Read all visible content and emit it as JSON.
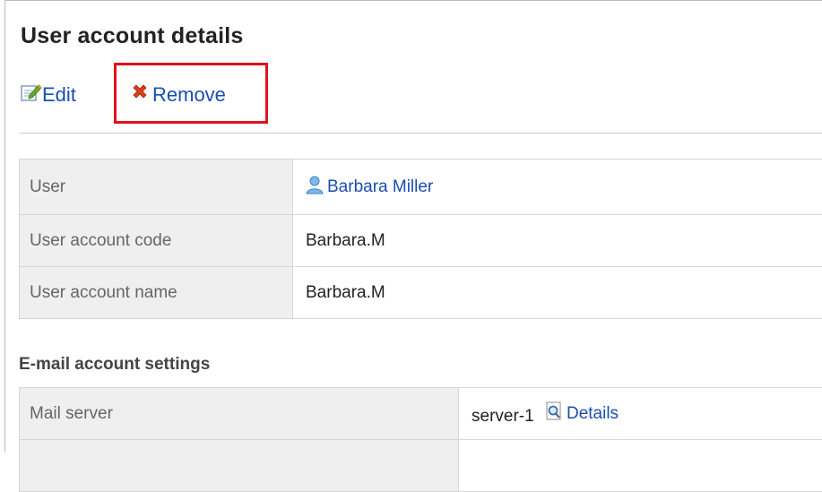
{
  "page": {
    "title": "User account details"
  },
  "toolbar": {
    "edit_label": "Edit",
    "remove_label": "Remove",
    "edit_icon": "edit-icon",
    "remove_icon": "remove-x-icon",
    "highlight_color": "#e0121b"
  },
  "account": {
    "rows": [
      {
        "label": "User",
        "value": "Barbara Miller",
        "icon": "user-icon"
      },
      {
        "label": "User account code",
        "value": "Barbara.M"
      },
      {
        "label": "User account name",
        "value": "Barbara.M"
      }
    ]
  },
  "email": {
    "heading": "E-mail account settings",
    "rows": [
      {
        "label": "Mail server",
        "value": "server-1",
        "link_label": "Details",
        "icon": "magnifier-icon"
      }
    ]
  },
  "colors": {
    "link": "#1a4db3",
    "label_bg": "#efefef",
    "border": "#d6d6d6"
  }
}
